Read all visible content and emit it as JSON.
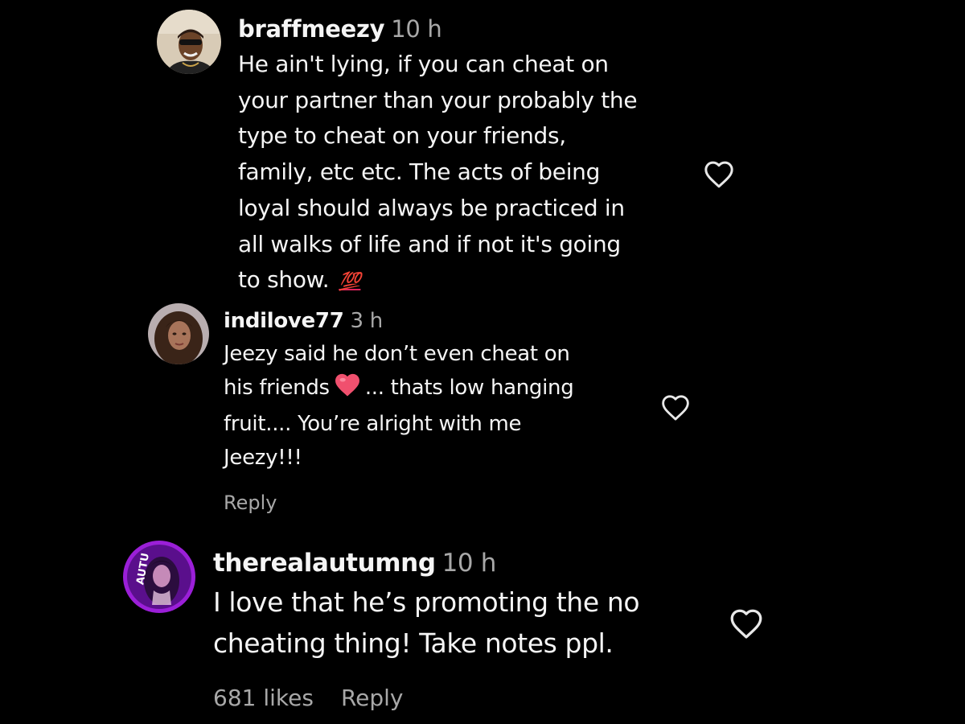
{
  "comments": [
    {
      "username": "braffmeezy",
      "time": "10 h",
      "lines": [
        "He ain't lying, if you can cheat on",
        "your partner than your probably the",
        "type to cheat on your friends,",
        "family, etc etc. The acts of being",
        "loyal should always be practiced in",
        "all walks of life and if not it's going",
        "to show."
      ],
      "emoji": "💯",
      "avatar_icon": "user-avatar-icon",
      "like_icon": "heart-outline-icon"
    },
    {
      "username": "indilove77",
      "time": "3 h",
      "line1": "Jeezy said he don’t even cheat on",
      "line2_before": "his friends",
      "line2_after": "... thats low hanging",
      "line3": "fruit.... You’re alright with me",
      "line4": "Jeezy!!!",
      "reply_label": "Reply",
      "avatar_icon": "user-avatar-icon",
      "like_icon": "heart-outline-icon",
      "emoji_icon": "red-heart-emoji-icon"
    },
    {
      "username": "therealautumng",
      "time": "10 h",
      "lines": [
        "I love that he’s promoting the no",
        "cheating thing! Take notes ppl."
      ],
      "likes_label": "681 likes",
      "reply_label": "Reply",
      "avatar_icon": "user-avatar-icon",
      "like_icon": "heart-outline-icon"
    }
  ],
  "colors": {
    "background": "#000000",
    "text": "#f5f5f5",
    "secondary": "#a8a8a8",
    "emoji_red": "#e0245e",
    "avatar_ring_purple": "#9b1fd8"
  }
}
